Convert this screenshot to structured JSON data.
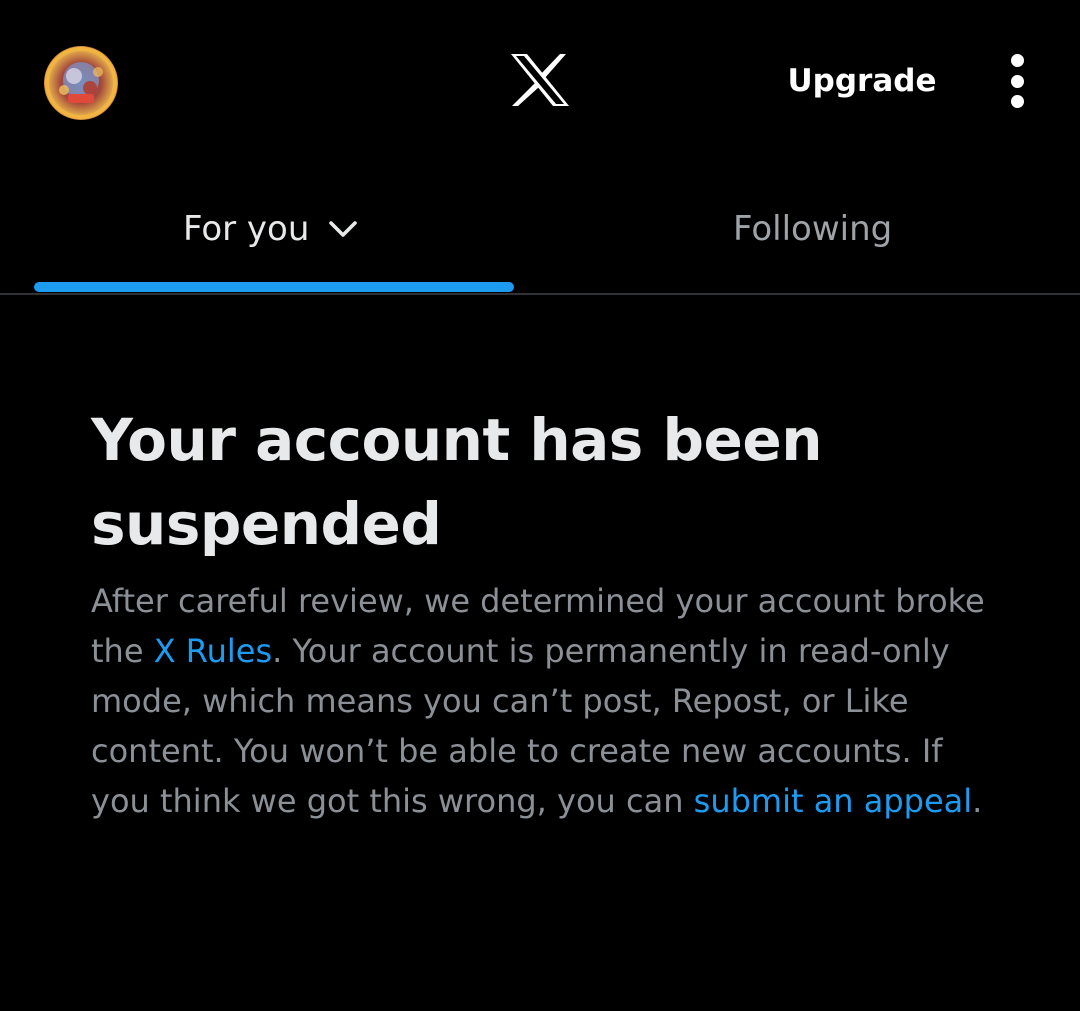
{
  "header": {
    "avatar_icon": "user-avatar",
    "logo_icon": "x-logo-icon",
    "upgrade_label": "Upgrade",
    "more_icon": "more-vertical-icon"
  },
  "tabs": [
    {
      "label": "For you",
      "selected": true,
      "dropdown_icon": "chevron-down-icon"
    },
    {
      "label": "Following",
      "selected": false
    }
  ],
  "notice": {
    "title": "Your account has been suspended",
    "text_part1": "After careful review, we determined your account broke the ",
    "rules_link": "X Rules",
    "text_part2": ". Your account is permanently in read-only mode, which means you can’t post, Repost, or Like content. You won’t be able to create new accounts. If you think we got this wrong, you can ",
    "appeal_link": "submit an appeal",
    "text_part3": "."
  },
  "colors": {
    "background": "#000000",
    "accent": "#1d9bf0",
    "primary_text": "#e7e9ea",
    "secondary_text": "#8b9096",
    "divider": "#2f3336"
  }
}
